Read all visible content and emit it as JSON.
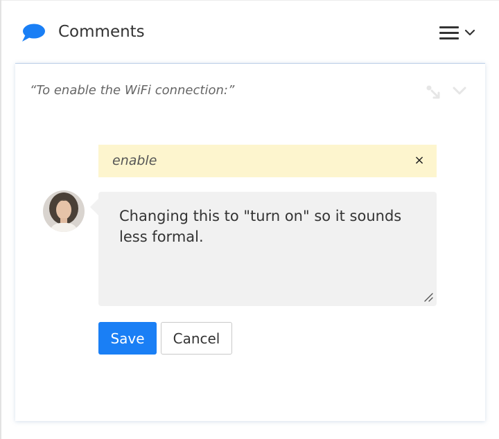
{
  "header": {
    "title": "Comments",
    "icon": "speech-bubble-icon",
    "accent_color": "#1a7ff5"
  },
  "card": {
    "quote": "“To enable the WiFi connection:”",
    "highlight": {
      "text": "enable",
      "close_glyph": "×",
      "background": "#fdf5ce"
    },
    "comment": {
      "text": "Changing this to \"turn on\" so it sounds less formal."
    },
    "buttons": {
      "save_label": "Save",
      "cancel_label": "Cancel"
    }
  }
}
